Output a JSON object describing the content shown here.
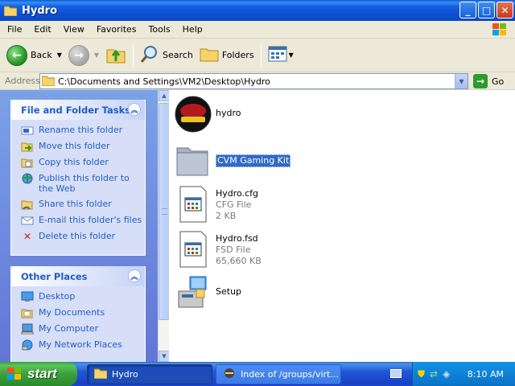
{
  "window": {
    "title": "Hydro",
    "buttons": {
      "minimize": "_",
      "maximize": "□",
      "close": "✕"
    }
  },
  "menu": [
    "File",
    "Edit",
    "View",
    "Favorites",
    "Tools",
    "Help"
  ],
  "toolbar": {
    "back_label": "Back",
    "search_label": "Search",
    "folders_label": "Folders"
  },
  "address": {
    "label": "Address",
    "value": "C:\\Documents and Settings\\VM2\\Desktop\\Hydro",
    "go_label": "Go"
  },
  "tasks_panel": {
    "title": "File and Folder Tasks",
    "items": [
      {
        "label": "Rename this folder",
        "icon": "rename-icon"
      },
      {
        "label": "Move this folder",
        "icon": "move-icon"
      },
      {
        "label": "Copy this folder",
        "icon": "copy-icon"
      },
      {
        "label": "Publish this folder to the Web",
        "icon": "publish-web-icon"
      },
      {
        "label": "Share this folder",
        "icon": "share-icon"
      },
      {
        "label": "E-mail this folder's files",
        "icon": "email-icon"
      },
      {
        "label": "Delete this folder",
        "icon": "delete-icon"
      }
    ]
  },
  "places_panel": {
    "title": "Other Places",
    "items": [
      {
        "label": "Desktop",
        "icon": "desktop-icon"
      },
      {
        "label": "My Documents",
        "icon": "documents-icon"
      },
      {
        "label": "My Computer",
        "icon": "computer-icon"
      },
      {
        "label": "My Network Places",
        "icon": "network-icon"
      }
    ]
  },
  "files": [
    {
      "name": "hydro",
      "type": "",
      "size": "",
      "icon": "hydro-thunder-icon"
    },
    {
      "name": "CVM Gaming Kit",
      "type": "",
      "size": "",
      "icon": "folder-icon",
      "selected": true
    },
    {
      "name": "Hydro.cfg",
      "type": "CFG File",
      "size": "2 KB",
      "icon": "cfg-file-icon"
    },
    {
      "name": "Hydro.fsd",
      "type": "FSD File",
      "size": "65,660 KB",
      "icon": "fsd-file-icon"
    },
    {
      "name": "Setup",
      "type": "",
      "size": "",
      "icon": "setup-icon"
    }
  ],
  "taskbar": {
    "start_label": "start",
    "tasks": [
      {
        "label": "Hydro",
        "active": true
      },
      {
        "label": "Index of /groups/virt...",
        "active": false
      }
    ],
    "clock": "8:10 AM"
  },
  "colors": {
    "titlebar": "#0b4fd0",
    "link_blue": "#215dc6",
    "selection": "#316ac5",
    "start_green": "#3b9f3b"
  }
}
